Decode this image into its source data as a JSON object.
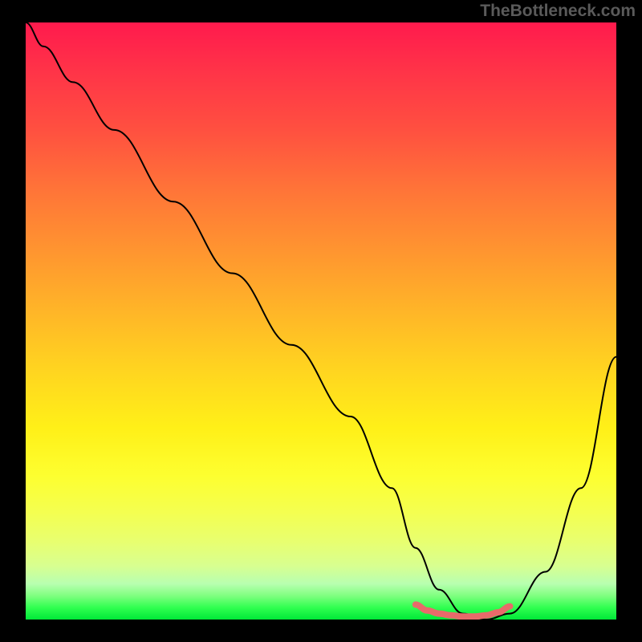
{
  "watermark": "TheBottleneck.com",
  "chart_data": {
    "type": "line",
    "title": "",
    "xlabel": "",
    "ylabel": "",
    "xlim": [
      0,
      100
    ],
    "ylim": [
      0,
      100
    ],
    "series": [
      {
        "name": "curve",
        "x": [
          0,
          3,
          8,
          15,
          25,
          35,
          45,
          55,
          62,
          66,
          70,
          74,
          78,
          82,
          88,
          94,
          100
        ],
        "y": [
          100,
          96,
          90,
          82,
          70,
          58,
          46,
          34,
          22,
          12,
          5,
          1,
          0,
          1,
          8,
          22,
          44
        ],
        "color": "#000000"
      },
      {
        "name": "highlight",
        "x": [
          66,
          68,
          70,
          72,
          74,
          76,
          78,
          80,
          82
        ],
        "y": [
          2.5,
          1.5,
          1.0,
          0.7,
          0.5,
          0.5,
          0.7,
          1.2,
          2.2
        ],
        "color": "#e86a6a"
      }
    ],
    "background_gradient": {
      "top": "#ff1a4d",
      "bottom": "#00e838",
      "description": "vertical red-to-green heat gradient"
    }
  }
}
